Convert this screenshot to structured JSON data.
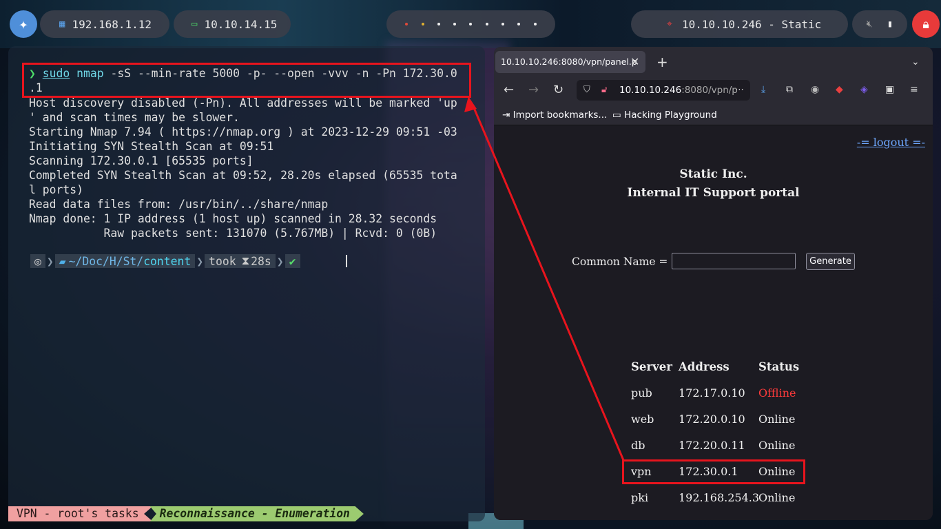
{
  "topbar": {
    "ip_local": "192.168.1.12",
    "ip_vpn": "10.10.14.15",
    "target": "10.10.10.246 - Static"
  },
  "terminal": {
    "command": {
      "sudo": "sudo",
      "nmap": "nmap",
      "args": "-sS --min-rate 5000 -p- --open -vvv -n -Pn 172.30.0",
      "args_cont": ".1"
    },
    "output": [
      "Host discovery disabled (-Pn). All addresses will be marked 'up",
      "' and scan times may be slower.",
      "Starting Nmap 7.94 ( https://nmap.org ) at 2023-12-29 09:51 -03",
      "Initiating SYN Stealth Scan at 09:51",
      "Scanning 172.30.0.1 [65535 ports]",
      "Completed SYN Stealth Scan at 09:52, 28.20s elapsed (65535 tota",
      "l ports)",
      "Read data files from: /usr/bin/../share/nmap",
      "Nmap done: 1 IP address (1 host up) scanned in 28.32 seconds",
      "           Raw packets sent: 131070 (5.767MB) | Rcvd: 0 (0B)"
    ],
    "prompt": {
      "path_prefix": "~/Doc/H/St/",
      "path_dir": "content",
      "took": "took",
      "duration": "28s"
    }
  },
  "statusbar": {
    "tasks": "VPN - root's tasks",
    "mode": "Reconnaissance - Enumeration"
  },
  "browser": {
    "tab_title": "10.10.10.246:8080/vpn/panel.p",
    "url_host": "10.10.10.246",
    "url_rest": ":8080/vpn/p",
    "bookmarks": [
      "Import bookmarks...",
      "Hacking Playground"
    ]
  },
  "page": {
    "logout": "-= logout =-",
    "title1": "Static Inc.",
    "title2": "Internal IT Support portal",
    "cn_label": "Common Name =",
    "generate": "Generate",
    "table": {
      "headers": [
        "Server",
        "Address",
        "Status"
      ],
      "rows": [
        [
          "pub",
          "172.17.0.10",
          "Offline"
        ],
        [
          "web",
          "172.20.0.10",
          "Online"
        ],
        [
          "db",
          "172.20.0.11",
          "Online"
        ],
        [
          "vpn",
          "172.30.0.1",
          "Online"
        ],
        [
          "pki",
          "192.168.254.3",
          "Online"
        ]
      ]
    }
  },
  "colors": {
    "highlight": "#e8141d",
    "offline": "#ff3b3b",
    "link": "#6ea8ff"
  }
}
